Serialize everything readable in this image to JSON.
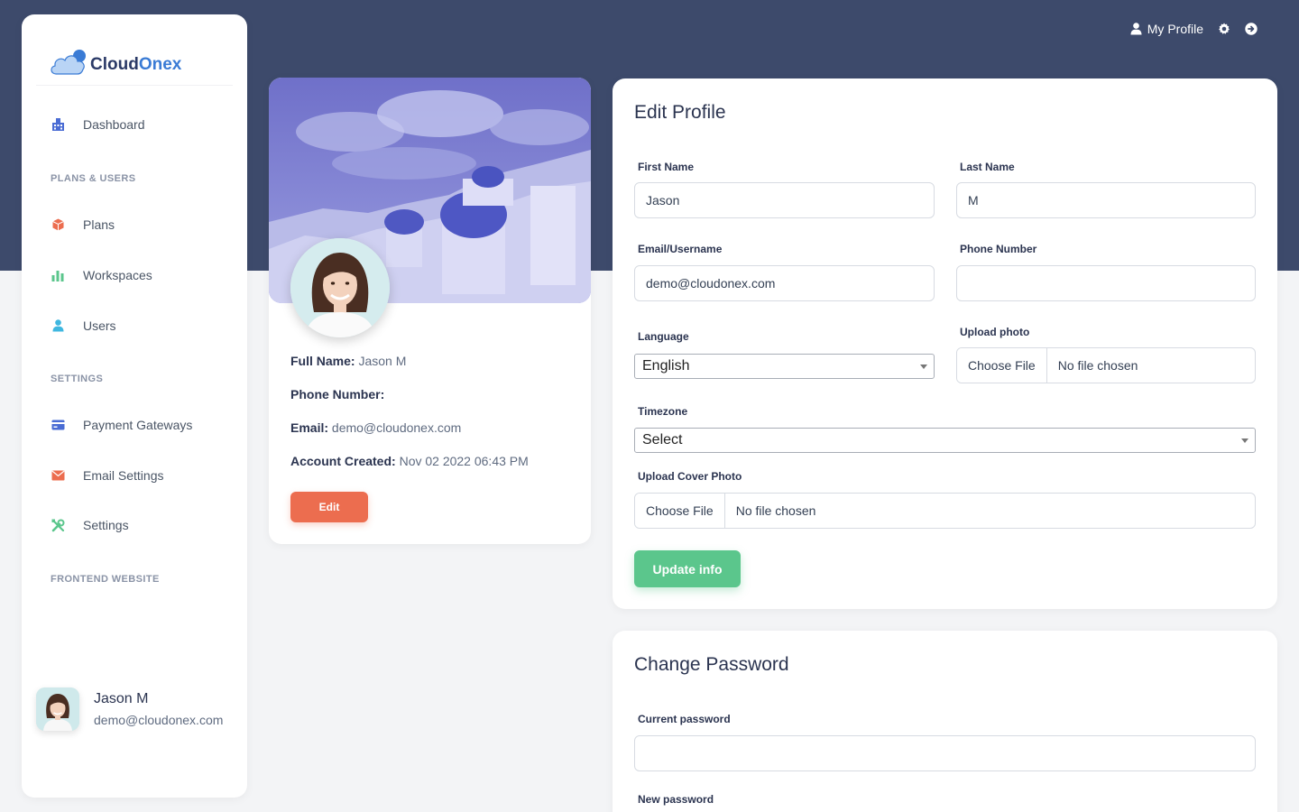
{
  "topnav": {
    "profile_label": "My Profile",
    "icons": [
      "user-icon",
      "gear-icon",
      "logout-icon"
    ]
  },
  "brand": {
    "part1": "Cloud",
    "part2": "Onex"
  },
  "sidebar": {
    "items": [
      {
        "label": "Dashboard",
        "icon": "dashboard-icon",
        "color": "#4a6cd4"
      },
      {
        "section": "PLANS & USERS"
      },
      {
        "label": "Plans",
        "icon": "box-icon",
        "color": "#ec6d4f"
      },
      {
        "label": "Workspaces",
        "icon": "bar-chart-icon",
        "color": "#5bc68c"
      },
      {
        "label": "Users",
        "icon": "user-icon",
        "color": "#3fb7e0"
      },
      {
        "section": "SETTINGS"
      },
      {
        "label": "Payment Gateways",
        "icon": "credit-card-icon",
        "color": "#4a6cd4"
      },
      {
        "label": "Email Settings",
        "icon": "envelope-icon",
        "color": "#ec6d4f"
      },
      {
        "label": "Settings",
        "icon": "tools-icon",
        "color": "#5bc68c"
      },
      {
        "section": "FRONTEND WEBSITE"
      }
    ],
    "user": {
      "name": "Jason M",
      "email": "demo@cloudonex.com"
    }
  },
  "profile_card": {
    "full_name_label": "Full Name:",
    "full_name": "Jason M",
    "phone_label": "Phone Number:",
    "phone": "",
    "email_label": "Email:",
    "email": "demo@cloudonex.com",
    "created_label": "Account Created:",
    "created": "Nov 02 2022 06:43 PM",
    "edit_label": "Edit"
  },
  "edit_profile": {
    "title": "Edit Profile",
    "first_name_label": "First Name",
    "first_name": "Jason",
    "last_name_label": "Last Name",
    "last_name": "M",
    "email_label": "Email/Username",
    "email": "demo@cloudonex.com",
    "phone_label": "Phone Number",
    "phone": "",
    "language_label": "Language",
    "language": "English",
    "upload_photo_label": "Upload photo",
    "choose_file": "Choose File",
    "no_file": "No file chosen",
    "timezone_label": "Timezone",
    "timezone": "Select",
    "cover_label": "Upload Cover Photo",
    "update_label": "Update info"
  },
  "change_password": {
    "title": "Change Password",
    "current_label": "Current password",
    "current_value": "",
    "new_label": "New password"
  }
}
